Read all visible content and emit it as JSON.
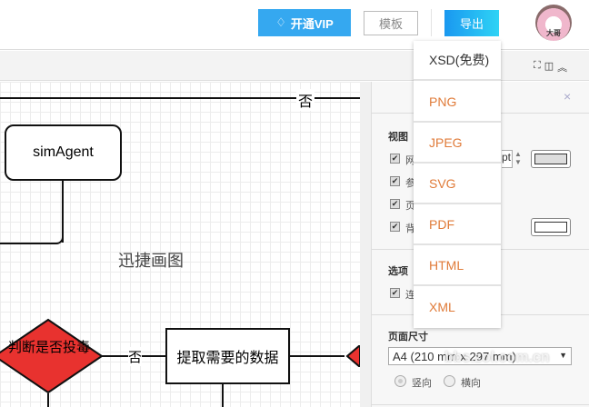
{
  "header": {
    "vip_label": "开通VIP",
    "template_label": "模板",
    "export_label": "导出",
    "avatar_text": "大哥"
  },
  "export_menu": [
    {
      "label": "XSD(免费)",
      "color": "#333333"
    },
    {
      "label": "PNG"
    },
    {
      "label": "JPEG"
    },
    {
      "label": "SVG"
    },
    {
      "label": "PDF"
    },
    {
      "label": "HTML"
    },
    {
      "label": "XML"
    }
  ],
  "canvas": {
    "title": "迅捷画图",
    "top_edge_label": "否",
    "node_simagent": "simAgent",
    "diamond": "判断是否投毒",
    "edge_no": "否",
    "process": "提取需要的数据"
  },
  "panel": {
    "view_heading": "视图",
    "view_items": [
      "网",
      "参",
      "页",
      "背"
    ],
    "grid_unit_suffix": "pt",
    "options_heading": "选项",
    "option_items": [
      "连"
    ],
    "page_size_heading": "页面尺寸",
    "page_size_value": "A4 (210 mm x 297 mm)",
    "orientation": [
      "竖向",
      "横向"
    ],
    "orientation_selected": "竖向"
  },
  "watermark": "bbs.zol.com.cn",
  "colors": {
    "accent": "#1a98f0",
    "export_item": "#e07b39",
    "diamond": "#e8322f"
  }
}
